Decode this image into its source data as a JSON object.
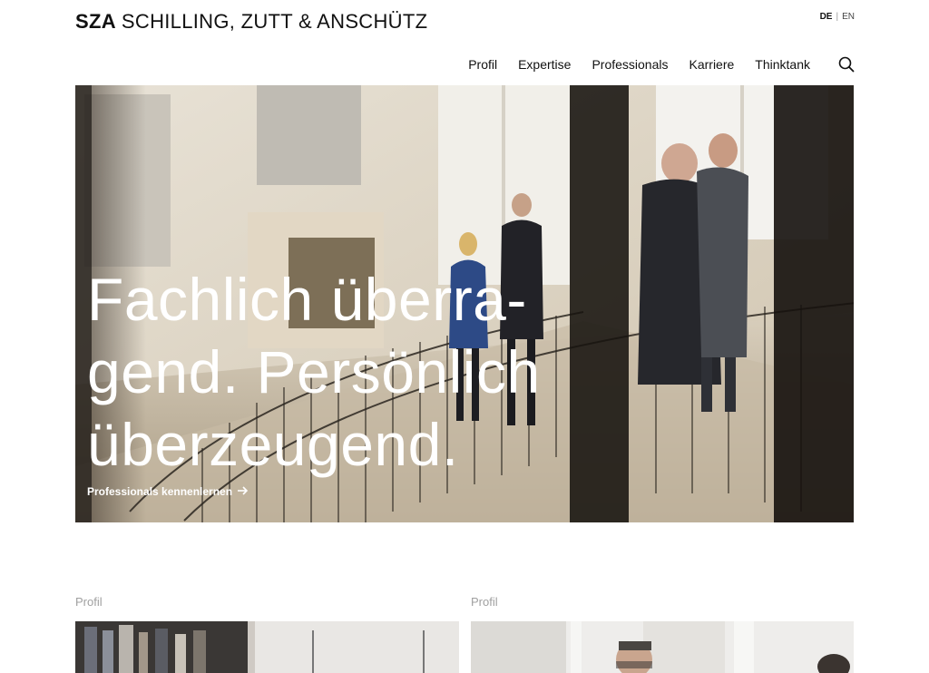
{
  "header": {
    "logo_abbr": "SZA",
    "logo_full": "SCHILLING, ZUTT & ANSCHÜTZ",
    "lang": {
      "active": "DE",
      "separator": "|",
      "other": "EN"
    }
  },
  "nav": {
    "items": [
      {
        "label": "Profil"
      },
      {
        "label": "Expertise"
      },
      {
        "label": "Professionals"
      },
      {
        "label": "Karriere"
      },
      {
        "label": "Thinktank"
      }
    ],
    "search_icon": "search-icon"
  },
  "hero": {
    "lines": [
      "Fachlich überra-",
      "gend. Persönlich",
      "überzeugend."
    ],
    "cta": "Professionals kennenlernen",
    "cta_icon": "arrow-right-icon"
  },
  "teasers": [
    {
      "label": "Profil"
    },
    {
      "label": "Profil"
    }
  ],
  "colors": {
    "text": "#111111",
    "muted": "#a0a0a0",
    "hero_text": "#ffffff"
  }
}
